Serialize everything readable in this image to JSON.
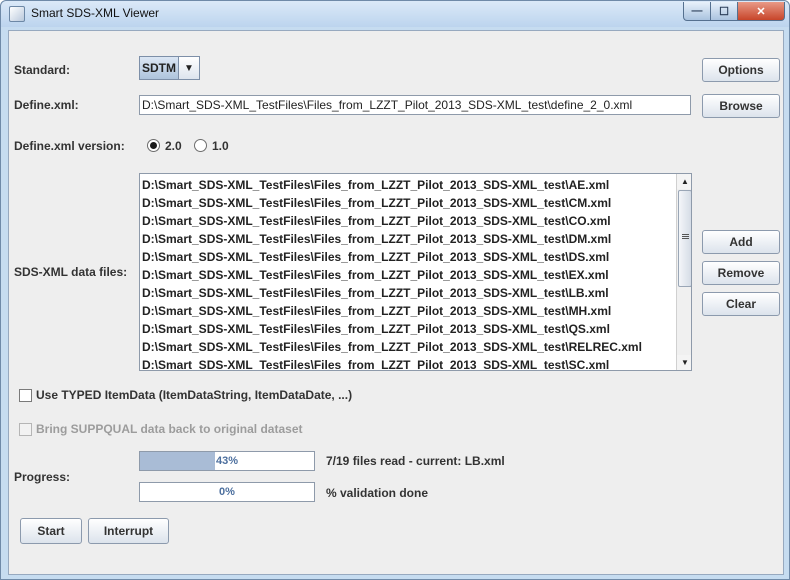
{
  "window": {
    "title": "Smart SDS-XML Viewer",
    "minimize_glyph": "—",
    "maximize_glyph": "☐",
    "close_glyph": "✕"
  },
  "standard": {
    "label": "Standard:",
    "selected": "SDTM",
    "arrow_glyph": "▼"
  },
  "define": {
    "label": "Define.xml:",
    "value": "D:\\Smart_SDS-XML_TestFiles\\Files_from_LZZT_Pilot_2013_SDS-XML_test\\define_2_0.xml"
  },
  "define_version": {
    "label": "Define.xml version:",
    "options": [
      {
        "label": "2.0",
        "selected": true
      },
      {
        "label": "1.0",
        "selected": false
      }
    ]
  },
  "buttons": {
    "options": "Options",
    "browse": "Browse",
    "add": "Add",
    "remove": "Remove",
    "clear": "Clear",
    "start": "Start",
    "interrupt": "Interrupt"
  },
  "data_files": {
    "label": "SDS-XML data files:",
    "items": [
      "D:\\Smart_SDS-XML_TestFiles\\Files_from_LZZT_Pilot_2013_SDS-XML_test\\AE.xml",
      "D:\\Smart_SDS-XML_TestFiles\\Files_from_LZZT_Pilot_2013_SDS-XML_test\\CM.xml",
      "D:\\Smart_SDS-XML_TestFiles\\Files_from_LZZT_Pilot_2013_SDS-XML_test\\CO.xml",
      "D:\\Smart_SDS-XML_TestFiles\\Files_from_LZZT_Pilot_2013_SDS-XML_test\\DM.xml",
      "D:\\Smart_SDS-XML_TestFiles\\Files_from_LZZT_Pilot_2013_SDS-XML_test\\DS.xml",
      "D:\\Smart_SDS-XML_TestFiles\\Files_from_LZZT_Pilot_2013_SDS-XML_test\\EX.xml",
      "D:\\Smart_SDS-XML_TestFiles\\Files_from_LZZT_Pilot_2013_SDS-XML_test\\LB.xml",
      "D:\\Smart_SDS-XML_TestFiles\\Files_from_LZZT_Pilot_2013_SDS-XML_test\\MH.xml",
      "D:\\Smart_SDS-XML_TestFiles\\Files_from_LZZT_Pilot_2013_SDS-XML_test\\QS.xml",
      "D:\\Smart_SDS-XML_TestFiles\\Files_from_LZZT_Pilot_2013_SDS-XML_test\\RELREC.xml",
      "D:\\Smart_SDS-XML_TestFiles\\Files_from_LZZT_Pilot_2013_SDS-XML_test\\SC.xml"
    ]
  },
  "typed_itemdata": {
    "label": "Use TYPED ItemData (ItemDataString, ItemDataDate, ...)",
    "checked": false
  },
  "suppqual": {
    "label": "Bring SUPPQUAL data back to original dataset",
    "checked": false,
    "enabled": false
  },
  "progress": {
    "label": "Progress:",
    "files_read": {
      "text": "43%",
      "fraction": 0.43,
      "status": "7/19 files read - current: LB.xml"
    },
    "validation": {
      "text": "0%",
      "fraction": 0.0,
      "status": "% validation done"
    }
  },
  "colors": {
    "progress_fill": "#a9bcd6",
    "progress_text": "#4c6f9e",
    "client_bg": "#eeeeee"
  }
}
